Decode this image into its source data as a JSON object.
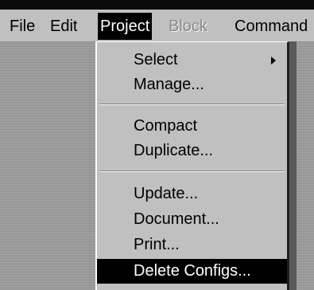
{
  "menubar": {
    "items": [
      {
        "label": "File"
      },
      {
        "label": "Edit"
      },
      {
        "label": "Project"
      },
      {
        "label": "Block"
      },
      {
        "label": "Command"
      }
    ]
  },
  "project_menu": {
    "items": [
      {
        "label": "Select"
      },
      {
        "label": "Manage..."
      },
      {
        "label": "Compact"
      },
      {
        "label": "Duplicate..."
      },
      {
        "label": "Update..."
      },
      {
        "label": "Document..."
      },
      {
        "label": "Print..."
      },
      {
        "label": "Delete Configs..."
      }
    ]
  }
}
